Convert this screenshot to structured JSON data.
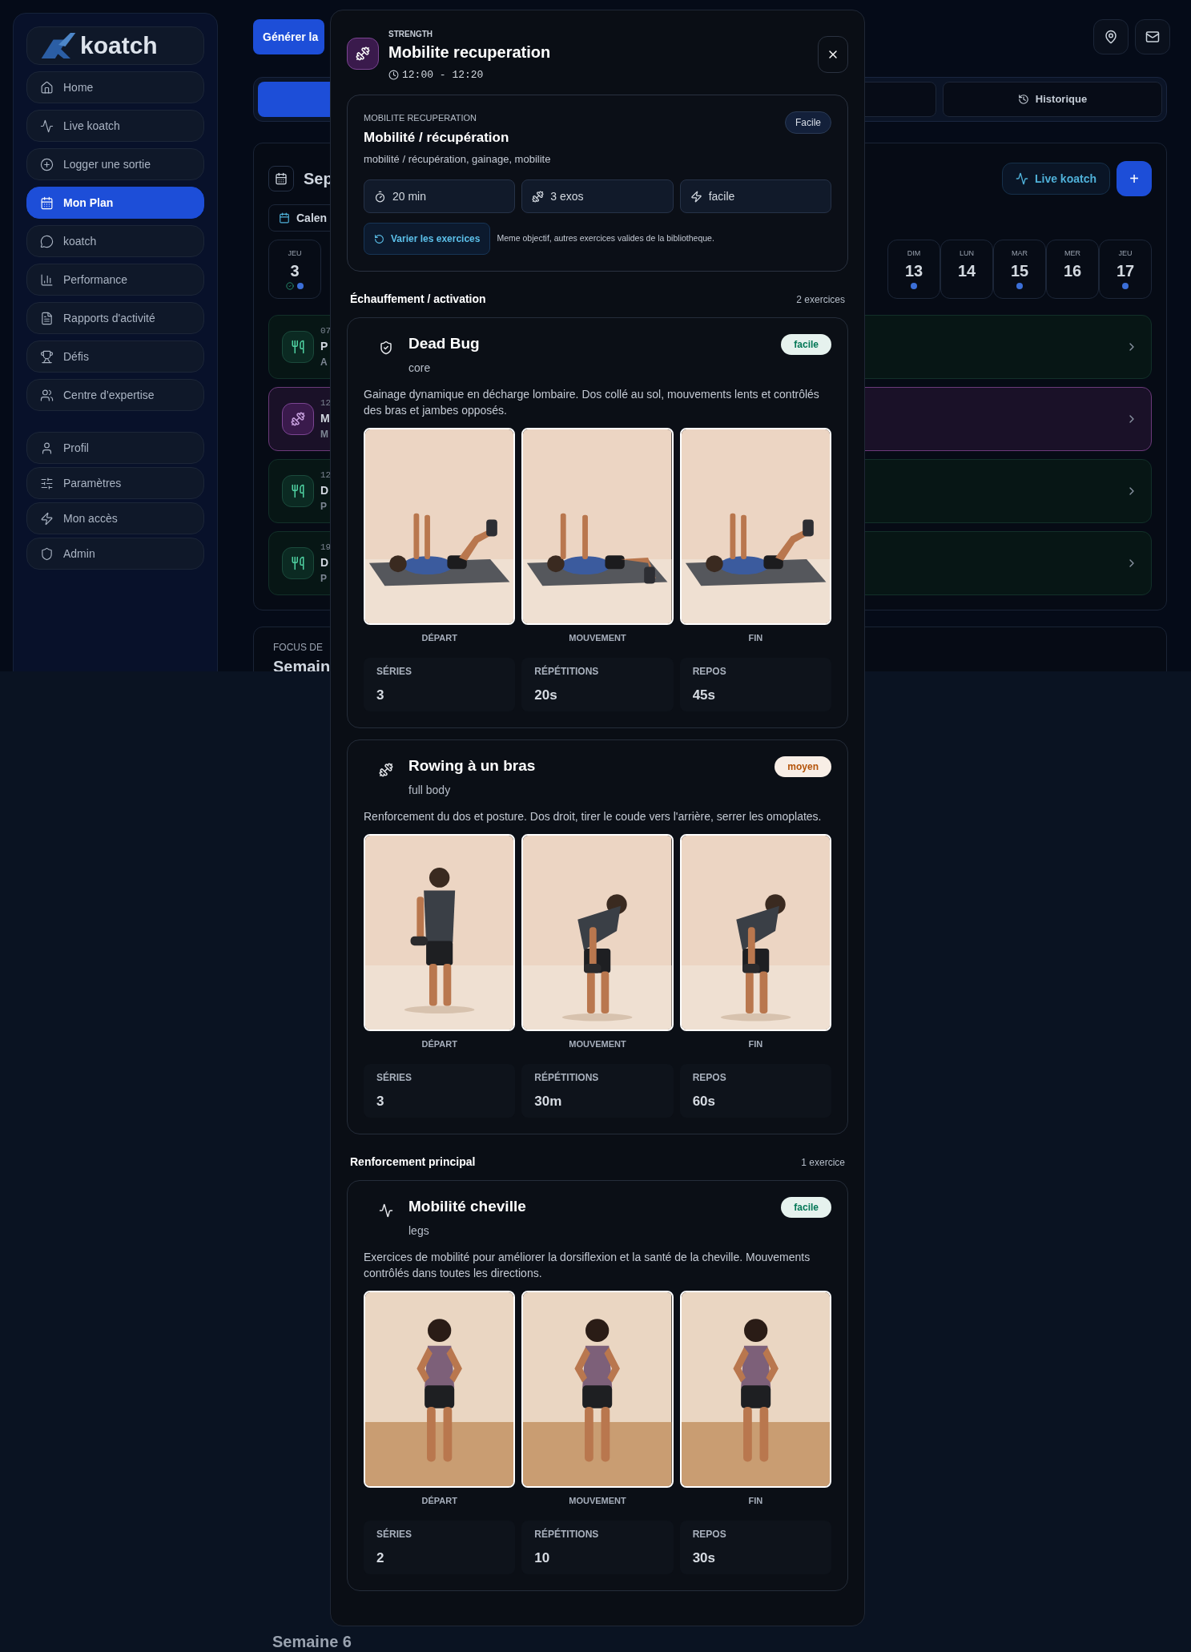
{
  "sidebar": {
    "logo": "koatch",
    "items": [
      {
        "label": "Home",
        "selected": false
      },
      {
        "label": "Live koatch",
        "selected": false
      },
      {
        "label": "Logger une sortie",
        "selected": false
      },
      {
        "label": "Mon Plan",
        "selected": true
      },
      {
        "label": "koatch",
        "selected": false
      },
      {
        "label": "Performance",
        "selected": false
      },
      {
        "label": "Rapports d'activité",
        "selected": false
      },
      {
        "label": "Défis",
        "selected": false
      },
      {
        "label": "Centre d’expertise",
        "selected": false
      }
    ],
    "secondary_items": [
      {
        "label": "Profil",
        "selected": false
      },
      {
        "label": "Paramètres",
        "selected": false
      },
      {
        "label": "Mon accès",
        "selected": false
      },
      {
        "label": "Admin",
        "selected": false
      }
    ]
  },
  "header": {
    "generate_button": "Générer la"
  },
  "tabs": [
    {
      "selected": true
    },
    {
      "selected": false
    },
    {
      "label": "Historique",
      "selected": false
    }
  ],
  "calendar": {
    "title": "Sep",
    "calendar_button": "Calen",
    "live_button": "Live koatch",
    "add_button": "+",
    "days": [
      {
        "day": "JEU",
        "date": "3",
        "done": true,
        "dot": true
      },
      {
        "day": "DIM",
        "date": "13",
        "done": false,
        "dot": true
      },
      {
        "day": "LUN",
        "date": "14",
        "done": false,
        "dot": false
      },
      {
        "day": "MAR",
        "date": "15",
        "done": false,
        "dot": true
      },
      {
        "day": "MER",
        "date": "16",
        "done": false,
        "dot": false
      },
      {
        "day": "JEU",
        "date": "17",
        "done": false,
        "dot": true
      }
    ],
    "events": [
      {
        "kind": "meal",
        "time": "07",
        "title": "P",
        "subtitle": "A"
      },
      {
        "kind": "workout",
        "time": "12",
        "title": "M",
        "subtitle": "M"
      },
      {
        "kind": "meal",
        "time": "12",
        "title": "D",
        "subtitle": "P"
      },
      {
        "kind": "meal",
        "time": "19",
        "title": "D",
        "subtitle": "P"
      }
    ]
  },
  "focus": {
    "label": "FOCUS DE",
    "title": "Semain"
  },
  "footer_week": "Semaine 6",
  "modal": {
    "category": "STRENGTH",
    "title": "Mobilite recuperation",
    "time": "12:00 - 12:20",
    "summary": {
      "overline": "MOBILITE RECUPERATION",
      "badge": "Facile",
      "title": "Mobilité / récupération",
      "tags": "mobilité / récupération, gainage, mobilite",
      "stats": [
        "20 min",
        "3 exos",
        "facile"
      ],
      "vary_button": "Varier les exercices",
      "note": "Meme objectif, autres exercices valides de la bibliotheque."
    },
    "sections": [
      {
        "title": "Échauffement / activation",
        "count": "2 exercices",
        "exercises": [
          {
            "name": "Dead Bug",
            "muscle": "core",
            "difficulty": "facile",
            "color": "#047857",
            "description": "Gainage dynamique en décharge lombaire. Dos collé au sol, mouvements lents et contrôlés des bras et jambes opposés.",
            "images": [
              {
                "caption": "DÉPART"
              },
              {
                "caption": "MOUVEMENT"
              },
              {
                "caption": "FIN"
              }
            ],
            "stats": [
              {
                "label": "SÉRIES",
                "value": "3"
              },
              {
                "label": "RÉPÉTITIONS",
                "value": "20s"
              },
              {
                "label": "REPOS",
                "value": "45s"
              }
            ]
          },
          {
            "name": "Rowing à un bras",
            "muscle": "full body",
            "difficulty": "moyen",
            "color": "#b45309",
            "description": "Renforcement du dos et posture. Dos droit, tirer le coude vers l'arrière, serrer les omoplates.",
            "images": [
              {
                "caption": "DÉPART"
              },
              {
                "caption": "MOUVEMENT"
              },
              {
                "caption": "FIN"
              }
            ],
            "stats": [
              {
                "label": "SÉRIES",
                "value": "3"
              },
              {
                "label": "RÉPÉTITIONS",
                "value": "30m"
              },
              {
                "label": "REPOS",
                "value": "60s"
              }
            ]
          }
        ]
      },
      {
        "title": "Renforcement principal",
        "count": "1 exercice",
        "exercises": [
          {
            "name": "Mobilité cheville",
            "muscle": "legs",
            "difficulty": "facile",
            "color": "#047857",
            "description": "Exercices de mobilité pour améliorer la dorsiflexion et la santé de la cheville. Mouvements contrôlés dans toutes les directions.",
            "images": [
              {
                "caption": "DÉPART"
              },
              {
                "caption": "MOUVEMENT"
              },
              {
                "caption": "FIN"
              }
            ],
            "stats": [
              {
                "label": "SÉRIES",
                "value": "2"
              },
              {
                "label": "RÉPÉTITIONS",
                "value": "10"
              },
              {
                "label": "REPOS",
                "value": "30s"
              }
            ]
          }
        ]
      }
    ]
  }
}
